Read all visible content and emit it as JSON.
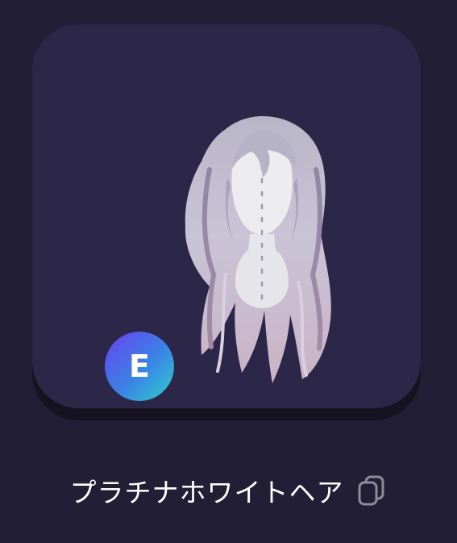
{
  "item": {
    "name": "プラチナホワイトヘア",
    "rarity_letter": "E",
    "image": "long-wavy-platinum-hair-icon"
  },
  "actions": {
    "copy_icon": "copy-icon"
  },
  "colors": {
    "background": "#221e35",
    "card": "#2c2648",
    "badge_gradient_start": "#6a3ff0",
    "badge_gradient_end": "#2fcfc9",
    "text": "#ffffff"
  }
}
